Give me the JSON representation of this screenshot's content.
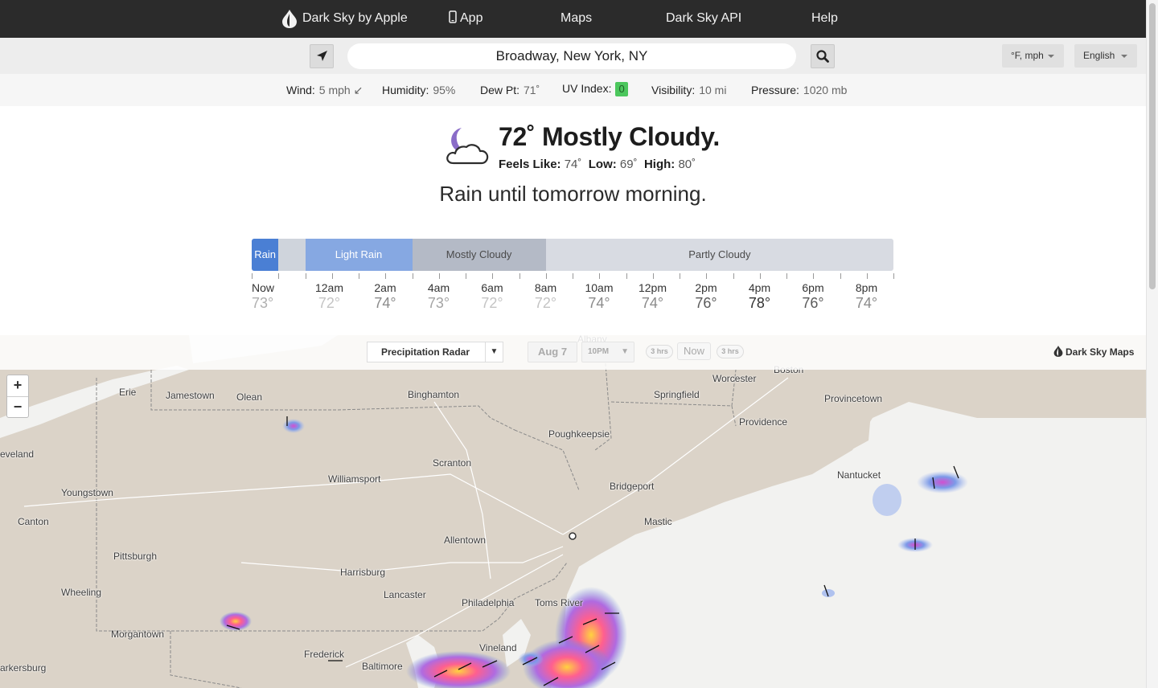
{
  "nav": {
    "brand": "Dark Sky by Apple",
    "app": "App",
    "maps": "Maps",
    "api": "Dark Sky API",
    "help": "Help"
  },
  "search": {
    "value": "Broadway, New York, NY",
    "units": "°F, mph",
    "language": "English"
  },
  "stats": {
    "wind_label": "Wind:",
    "wind_value": "5 mph ↙",
    "humidity_label": "Humidity:",
    "humidity_value": "95%",
    "dew_label": "Dew Pt:",
    "dew_value": "71˚",
    "uv_label": "UV Index:",
    "uv_value": "0",
    "vis_label": "Visibility:",
    "vis_value": "10 mi",
    "pressure_label": "Pressure:",
    "pressure_value": "1020 mb"
  },
  "current": {
    "icon": "partly-cloudy-night-icon",
    "summary": "72˚ Mostly Cloudy.",
    "feels_label": "Feels Like:",
    "feels_value": "74˚",
    "low_label": "Low:",
    "low_value": "69˚",
    "high_label": "High:",
    "high_value": "80˚",
    "next_hours": "Rain until tomorrow morning."
  },
  "timeline": {
    "segments": [
      {
        "label": "Rain",
        "start": 0,
        "end": 1,
        "color": "#4a7fd4",
        "text_color": "#ffffff"
      },
      {
        "label": "",
        "start": 1,
        "end": 2,
        "color": "#cfd4dc",
        "text_color": "#555555"
      },
      {
        "label": "Light Rain",
        "start": 2,
        "end": 6,
        "color": "#86a8e2",
        "text_color": "#ffffff"
      },
      {
        "label": "Mostly Cloudy",
        "start": 6,
        "end": 11,
        "color": "#b4bac6",
        "text_color": "#4a4a4a"
      },
      {
        "label": "Partly Cloudy",
        "start": 11,
        "end": 24,
        "color": "#d8dbe2",
        "text_color": "#4a4a4a"
      }
    ],
    "hours": [
      {
        "label": "Now",
        "temp": "73°",
        "color": "#b0b0b0"
      },
      {
        "label": "12am",
        "temp": "72°",
        "color": "#c4c4c4"
      },
      {
        "label": "2am",
        "temp": "74°",
        "color": "#8a8a8a"
      },
      {
        "label": "4am",
        "temp": "73°",
        "color": "#a4a4a4"
      },
      {
        "label": "6am",
        "temp": "72°",
        "color": "#c4c4c4"
      },
      {
        "label": "8am",
        "temp": "72°",
        "color": "#c4c4c4"
      },
      {
        "label": "10am",
        "temp": "74°",
        "color": "#8a8a8a"
      },
      {
        "label": "12pm",
        "temp": "74°",
        "color": "#8a8a8a"
      },
      {
        "label": "2pm",
        "temp": "76°",
        "color": "#5a5a5a"
      },
      {
        "label": "4pm",
        "temp": "78°",
        "color": "#333333"
      },
      {
        "label": "6pm",
        "temp": "76°",
        "color": "#5a5a5a"
      },
      {
        "label": "8pm",
        "temp": "74°",
        "color": "#8a8a8a"
      }
    ]
  },
  "map": {
    "layer": "Precipitation Radar",
    "date": "Aug 7",
    "time": "10PM",
    "back": "3 hrs",
    "now": "Now",
    "forward": "3 hrs",
    "brand": "Dark Sky Maps",
    "zoom_in": "+",
    "zoom_out": "−",
    "cities": [
      "Albany",
      "Boston",
      "Worcester",
      "Erie",
      "Jamestown",
      "Olean",
      "Binghamton",
      "Springfield",
      "Provincetown",
      "Providence",
      "Poughkeepsie",
      "eveland",
      "Scranton",
      "Nantucket",
      "Youngstown",
      "Williamsport",
      "Bridgeport",
      "Canton",
      "Mastic",
      "Allentown",
      "Pittsburgh",
      "Harrisburg",
      "Wheeling",
      "Lancaster",
      "Philadelphia",
      "Toms River",
      "Morgantown",
      "Vineland",
      "Frederick",
      "Baltimore",
      "arkersburg"
    ]
  }
}
